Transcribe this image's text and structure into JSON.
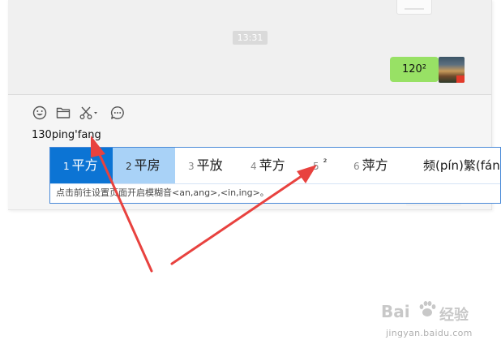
{
  "chat": {
    "timestamp": "13:31",
    "sent_message": "120²"
  },
  "toolbar": {
    "icons": [
      "emoji-icon",
      "folder-icon",
      "scissors-icon",
      "chat-bubble-icon"
    ]
  },
  "composer": {
    "input_value": "130ping'fang"
  },
  "ime": {
    "candidates": [
      {
        "num": "1",
        "word": "平方"
      },
      {
        "num": "2",
        "word": "平房"
      },
      {
        "num": "3",
        "word": "平放"
      },
      {
        "num": "4",
        "word": "苹方"
      },
      {
        "num": "5",
        "word": "²"
      },
      {
        "num": "6",
        "word": "萍方"
      },
      {
        "num": "",
        "word": "频(pín)繁(fán)"
      }
    ],
    "tip": "点击前往设置页面开启模糊音<an,ang>,<in,ing>。",
    "selected_index": 1
  },
  "watermark": {
    "logo": "Bai",
    "logo_cn": "经验",
    "url": "jingyan.baidu.com"
  },
  "colors": {
    "bubble": "#98e165",
    "candidate_selected": "#0c74d4",
    "candidate_hover": "#a9d2f7",
    "ime_border": "#4a8ad8",
    "arrow": "#e8423f"
  }
}
